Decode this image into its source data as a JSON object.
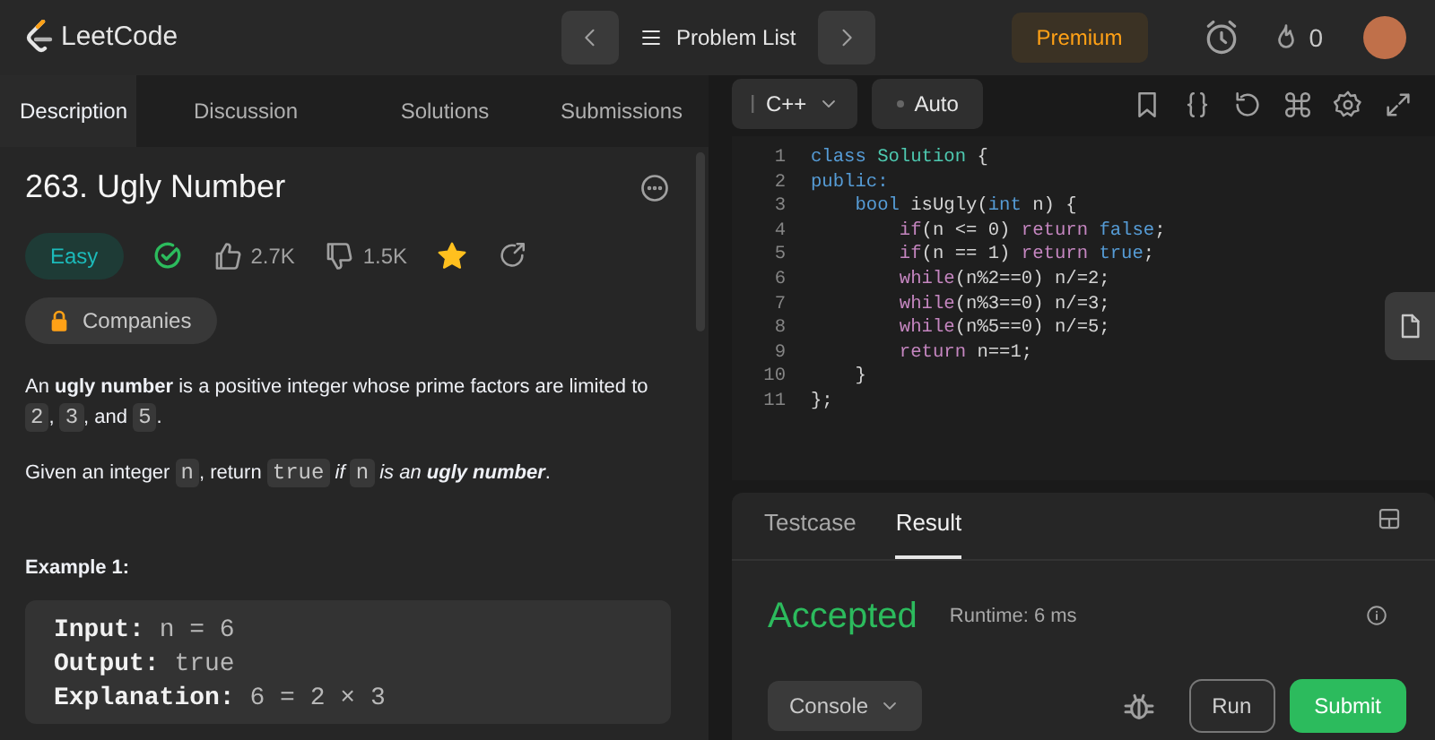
{
  "header": {
    "logo_text": "LeetCode",
    "problem_list": "Problem List",
    "premium": "Premium",
    "streak": "0"
  },
  "left_tabs": [
    {
      "label": "Description",
      "selected": true
    },
    {
      "label": "Discussion",
      "selected": false
    },
    {
      "label": "Solutions",
      "selected": false
    },
    {
      "label": "Submissions",
      "selected": false
    }
  ],
  "problem": {
    "title": "263. Ugly Number",
    "difficulty": "Easy",
    "solved": true,
    "likes": "2.7K",
    "dislikes": "1.5K",
    "favorited": true,
    "companies": "Companies",
    "paragraphs": [
      [
        {
          "kind": "text",
          "text": "An "
        },
        {
          "kind": "bold",
          "text": "ugly number"
        },
        {
          "kind": "text",
          "text": " is a positive integer whose prime factors are limited to "
        },
        {
          "kind": "code",
          "text": "2"
        },
        {
          "kind": "text",
          "text": ", "
        },
        {
          "kind": "code",
          "text": "3"
        },
        {
          "kind": "text",
          "text": ", and "
        },
        {
          "kind": "code",
          "text": "5"
        },
        {
          "kind": "text",
          "text": "."
        }
      ],
      [
        {
          "kind": "text",
          "text": "Given an integer "
        },
        {
          "kind": "code",
          "text": "n"
        },
        {
          "kind": "text",
          "text": ", return "
        },
        {
          "kind": "code",
          "text": "true"
        },
        {
          "kind": "italic",
          "text": " if "
        },
        {
          "kind": "code",
          "text": "n"
        },
        {
          "kind": "italic",
          "text": " is an "
        },
        {
          "kind": "bolditalic",
          "text": "ugly number"
        },
        {
          "kind": "text",
          "text": "."
        }
      ]
    ],
    "example_title": "Example 1:",
    "example_lines": [
      {
        "label": "Input:",
        "value": "n = 6"
      },
      {
        "label": "Output:",
        "value": "true"
      },
      {
        "label": "Explanation:",
        "value": "6 = 2 × 3"
      }
    ]
  },
  "editor": {
    "language": "C++",
    "mode": "Auto",
    "lines": [
      {
        "number": "1",
        "tokens": [
          {
            "kind": "keyword",
            "text": "class "
          },
          {
            "kind": "type",
            "text": "Solution"
          },
          {
            "kind": "plain",
            "text": " {"
          }
        ]
      },
      {
        "number": "2",
        "tokens": [
          {
            "kind": "keyword",
            "text": "public:"
          }
        ]
      },
      {
        "number": "3",
        "tokens": [
          {
            "kind": "keyword",
            "text": "    bool"
          },
          {
            "kind": "plain",
            "text": " isUgly("
          },
          {
            "kind": "keyword",
            "text": "int"
          },
          {
            "kind": "plain",
            "text": " n) {"
          }
        ]
      },
      {
        "number": "4",
        "tokens": [
          {
            "kind": "control",
            "text": "        if"
          },
          {
            "kind": "plain",
            "text": "(n <= 0) "
          },
          {
            "kind": "control",
            "text": "return "
          },
          {
            "kind": "keyword",
            "text": "false"
          },
          {
            "kind": "plain",
            "text": ";"
          }
        ]
      },
      {
        "number": "5",
        "tokens": [
          {
            "kind": "control",
            "text": "        if"
          },
          {
            "kind": "plain",
            "text": "(n == 1) "
          },
          {
            "kind": "control",
            "text": "return "
          },
          {
            "kind": "keyword",
            "text": "true"
          },
          {
            "kind": "plain",
            "text": ";"
          }
        ]
      },
      {
        "number": "6",
        "tokens": [
          {
            "kind": "control",
            "text": "        while"
          },
          {
            "kind": "plain",
            "text": "(n%2==0) n/=2;"
          }
        ]
      },
      {
        "number": "7",
        "tokens": [
          {
            "kind": "control",
            "text": "        while"
          },
          {
            "kind": "plain",
            "text": "(n%3==0) n/=3;"
          }
        ]
      },
      {
        "number": "8",
        "tokens": [
          {
            "kind": "control",
            "text": "        while"
          },
          {
            "kind": "plain",
            "text": "(n%5==0) n/=5;"
          }
        ]
      },
      {
        "number": "9",
        "tokens": [
          {
            "kind": "control",
            "text": "        return"
          },
          {
            "kind": "plain",
            "text": " n==1;"
          }
        ]
      },
      {
        "number": "10",
        "tokens": [
          {
            "kind": "plain",
            "text": "    }"
          }
        ]
      },
      {
        "number": "11",
        "tokens": [
          {
            "kind": "plain",
            "text": "};"
          }
        ]
      }
    ]
  },
  "result_tabs": [
    {
      "label": "Testcase",
      "selected": false
    },
    {
      "label": "Result",
      "selected": true
    }
  ],
  "result": {
    "status": "Accepted",
    "runtime": "Runtime: 6 ms"
  },
  "actions": {
    "console": "Console",
    "run": "Run",
    "submit": "Submit"
  }
}
